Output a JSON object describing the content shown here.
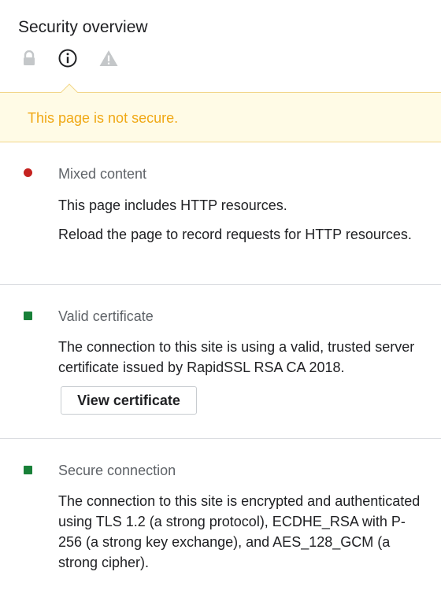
{
  "header": {
    "title": "Security overview",
    "tabs": [
      {
        "icon": "lock-icon"
      },
      {
        "icon": "info-icon",
        "selected": true
      },
      {
        "icon": "warning-icon"
      }
    ]
  },
  "banner": {
    "text": "This page is not secure.",
    "text_color": "#f0a814",
    "background": "#fffbe6"
  },
  "sections": [
    {
      "status": "insecure",
      "status_color": "#c5221f",
      "title": "Mixed content",
      "paragraphs": [
        "This page includes HTTP resources.",
        "Reload the page to record requests for HTTP resources."
      ]
    },
    {
      "status": "secure",
      "status_color": "#188038",
      "title": "Valid certificate",
      "paragraphs": [
        "The connection to this site is using a valid, trusted server certificate issued by RapidSSL RSA CA 2018."
      ],
      "button_label": "View certificate"
    },
    {
      "status": "secure",
      "status_color": "#188038",
      "title": "Secure connection",
      "paragraphs": [
        "The connection to this site is encrypted and authenticated using TLS 1.2 (a strong protocol), ECDHE_RSA with P-256 (a strong key exchange), and AES_128_GCM (a strong cipher)."
      ]
    }
  ]
}
